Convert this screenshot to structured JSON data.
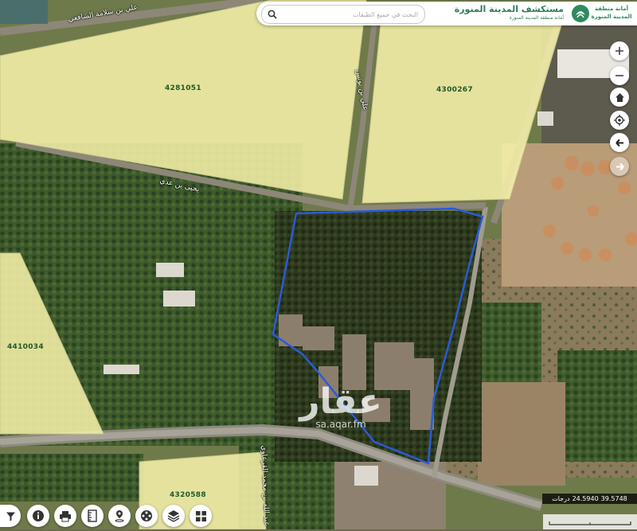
{
  "header": {
    "search_placeholder": "البحث في جميع الطبقات",
    "title": "مستكشف المدينة المنورة",
    "subtitle": "أمانة منطقة المدينة المنورة",
    "logo_line1": "أمانة منطقة",
    "logo_line2": "المدينة المنورة",
    "accent_color": "#2f7b5c"
  },
  "parcels": [
    {
      "id": "4281051"
    },
    {
      "id": "4300267"
    },
    {
      "id": "4410034"
    },
    {
      "id": "4320588"
    }
  ],
  "streets": [
    {
      "name": "علي بن سلامة الشافعي"
    },
    {
      "name": "يحيى بن عدي"
    },
    {
      "name": "علي بن يونس"
    },
    {
      "name": "عبد الله بن محمد القرعاوي"
    }
  ],
  "map_controls": [
    {
      "name": "zoom-in",
      "icon": "plus-icon"
    },
    {
      "name": "zoom-out",
      "icon": "minus-icon"
    },
    {
      "name": "home",
      "icon": "home-icon"
    },
    {
      "name": "locate",
      "icon": "locate-icon"
    },
    {
      "name": "back",
      "icon": "arrow-left-icon"
    },
    {
      "name": "forward",
      "icon": "arrow-right-icon"
    }
  ],
  "toolbar": [
    {
      "name": "filter",
      "icon": "filter-icon"
    },
    {
      "name": "info",
      "icon": "info-icon"
    },
    {
      "name": "print",
      "icon": "print-icon"
    },
    {
      "name": "measure",
      "icon": "measure-icon"
    },
    {
      "name": "place",
      "icon": "pin-icon"
    },
    {
      "name": "basemap",
      "icon": "film-reel-icon"
    },
    {
      "name": "layers",
      "icon": "layers-icon"
    },
    {
      "name": "apps",
      "icon": "grid-icon"
    }
  ],
  "coordinates": {
    "lat": "24.5940",
    "lon": "39.5748",
    "unit": "درجات"
  },
  "watermark": {
    "logo": "عقار",
    "url": "sa.aqar.fm"
  },
  "colors": {
    "parcel_fill": "#f5f0a8",
    "selection_outline": "#2a5bd8"
  }
}
